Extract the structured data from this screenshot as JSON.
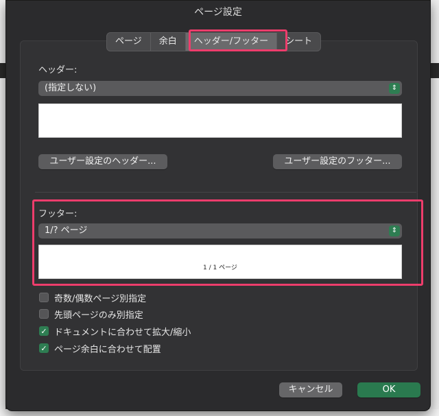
{
  "dialog": {
    "title": "ページ設定"
  },
  "tabs": [
    {
      "label": "ページ",
      "active": false
    },
    {
      "label": "余白",
      "active": false
    },
    {
      "label": "ヘッダー/フッター",
      "active": true
    },
    {
      "label": "シート",
      "active": false
    }
  ],
  "header": {
    "label": "ヘッダー:",
    "selected": "(指定しない)",
    "preview_text": "",
    "custom_button": "ユーザー設定のヘッダー..."
  },
  "footer": {
    "label": "フッター:",
    "selected": "1/? ページ",
    "preview_text": "1 / 1 ページ",
    "custom_button": "ユーザー設定のフッター..."
  },
  "options": [
    {
      "label": "奇数/偶数ページ別指定",
      "checked": false
    },
    {
      "label": "先頭ページのみ別指定",
      "checked": false
    },
    {
      "label": "ドキュメントに合わせて拡大/縮小",
      "checked": true
    },
    {
      "label": "ページ余白に合わせて配置",
      "checked": true
    }
  ],
  "buttons": {
    "cancel": "キャンセル",
    "ok": "OK"
  },
  "icons": {
    "select_chevron": "up-down-chevron-icon",
    "checkmark": "checkmark-icon"
  },
  "colors": {
    "highlight": "#ee3d6c",
    "accent_green": "#2e7d52"
  }
}
